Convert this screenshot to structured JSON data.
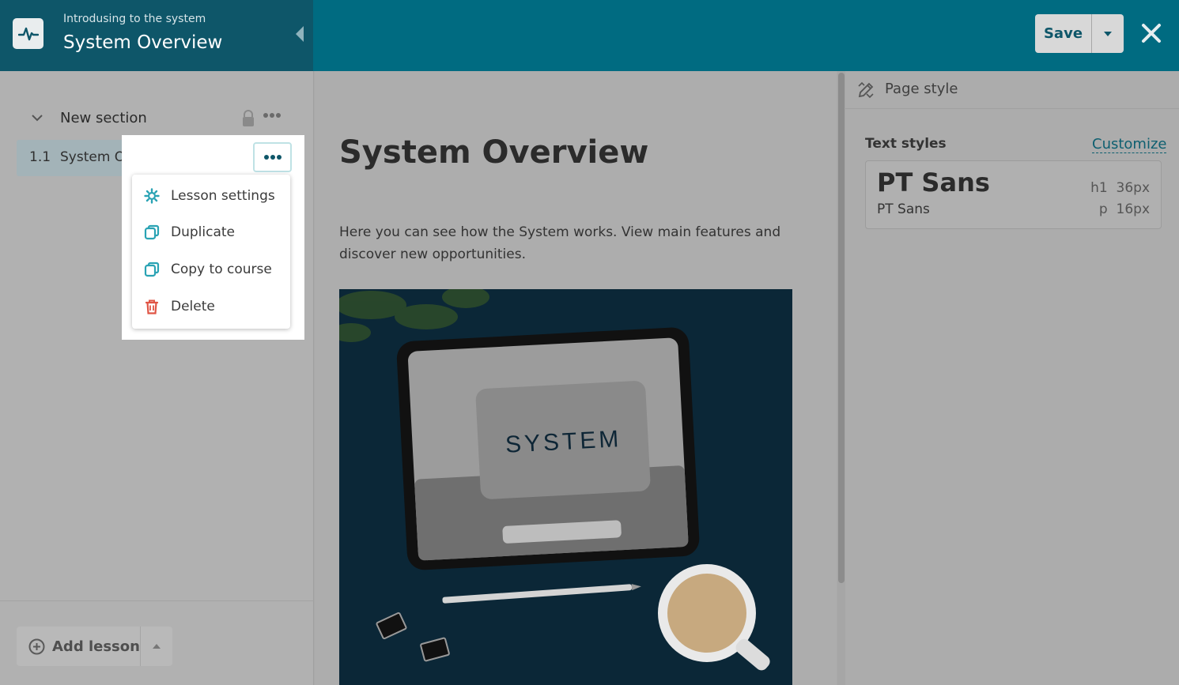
{
  "header": {
    "course_subtitle": "Introdusing to the system",
    "course_title": "System Overview",
    "save_label": "Save"
  },
  "sidebar": {
    "section": {
      "label": "New section"
    },
    "lessons": [
      {
        "number": "1.1",
        "label": "System Overview"
      }
    ],
    "add_lesson_label": "Add lesson"
  },
  "lesson_menu": {
    "items": [
      {
        "label": "Lesson settings",
        "icon": "gear-icon"
      },
      {
        "label": "Duplicate",
        "icon": "duplicate-icon"
      },
      {
        "label": "Copy to course",
        "icon": "copy-icon"
      },
      {
        "label": "Delete",
        "icon": "trash-icon"
      }
    ]
  },
  "editor": {
    "title": "System Overview",
    "paragraph": "Here you can see how the System works. View main features and discover new opportunities.",
    "image_text": "SYSTEM"
  },
  "right_panel": {
    "title": "Page style",
    "text_styles_label": "Text styles",
    "customize_label": "Customize",
    "h1_font": "PT Sans",
    "p_font": "PT Sans",
    "h1_tag": "h1",
    "h1_size": "36px",
    "p_tag": "p",
    "p_size": "16px"
  },
  "colors": {
    "brand": "#006b81",
    "brand_dark": "#0e5669",
    "accent_icon": "#2aa3b4",
    "danger": "#e05545"
  }
}
